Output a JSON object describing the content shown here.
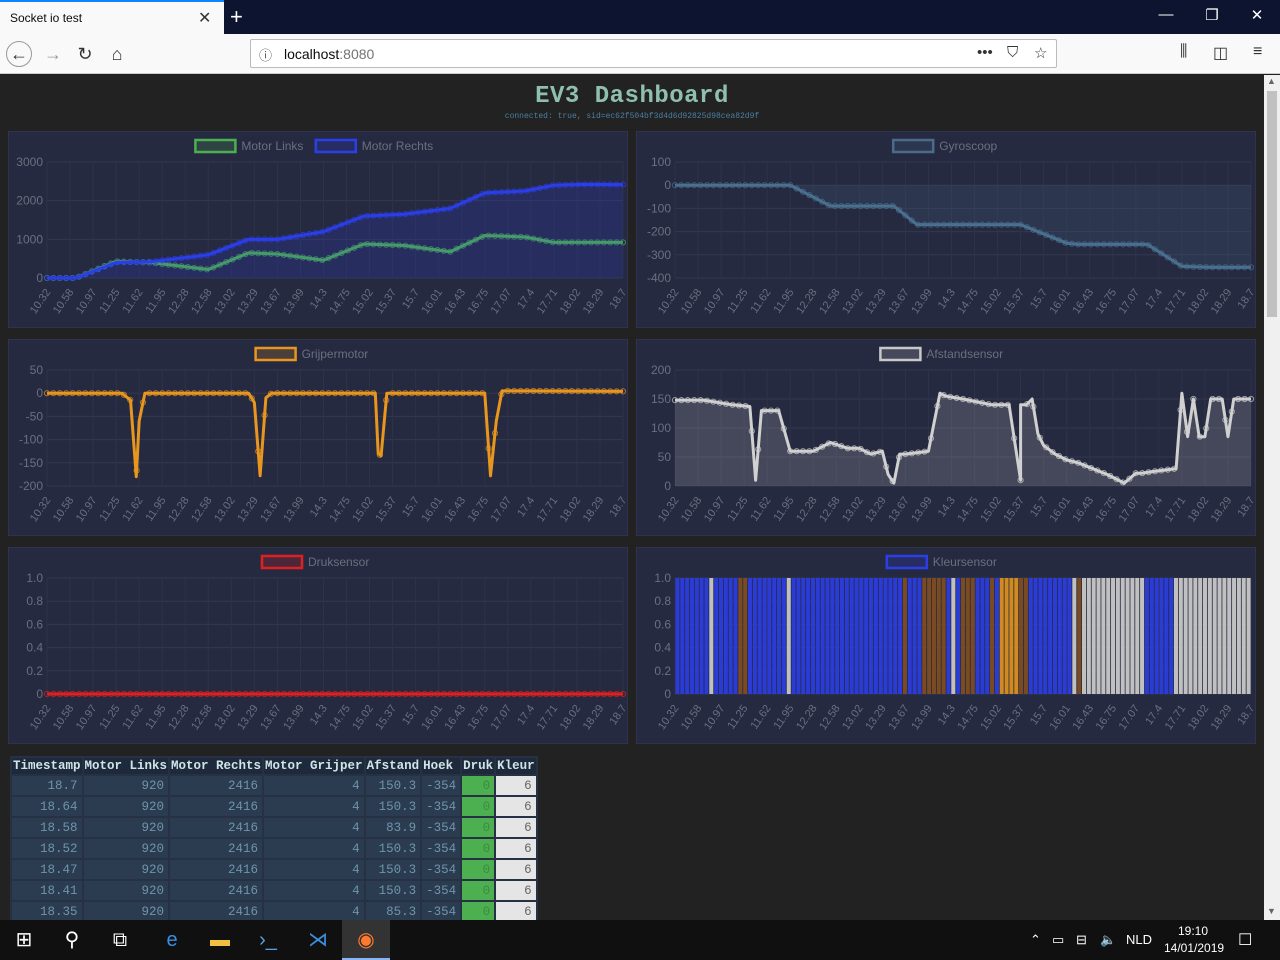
{
  "browser": {
    "tab_title": "Socket io test",
    "tab_close": "✕",
    "new_tab": "+",
    "url_host": "localhost",
    "url_port": ":8080",
    "win_minimize": "—",
    "win_restore": "❐",
    "win_close": "✕"
  },
  "dashboard": {
    "title": "EV3 Dashboard",
    "status": "connected: true, sid=ec62f504bf3d4d6d92825d98cea82d9f"
  },
  "ticks": [
    "10.32",
    "10.58",
    "10.97",
    "11.25",
    "11.62",
    "11.95",
    "12.28",
    "12.58",
    "13.02",
    "13.29",
    "13.67",
    "13.99",
    "14.3",
    "14.75",
    "15.02",
    "15.37",
    "15.7",
    "16.01",
    "16.43",
    "16.75",
    "17.07",
    "17.4",
    "17.71",
    "18.02",
    "18.29",
    "18.7"
  ],
  "chart_data": [
    {
      "type": "line",
      "id": "motors",
      "legend": [
        {
          "name": "Motor Links",
          "color": "#4caf50"
        },
        {
          "name": "Motor Rechts",
          "color": "#2b3ee8"
        }
      ],
      "ylim": [
        0,
        3000
      ],
      "yticks": [
        "3000",
        "2000",
        "1000",
        "0"
      ],
      "series": [
        {
          "name": "Motor Links",
          "color": "#4caf50",
          "x": [
            0,
            0.05,
            0.12,
            0.18,
            0.28,
            0.35,
            0.4,
            0.48,
            0.55,
            0.62,
            0.7,
            0.76,
            0.83,
            0.88,
            0.93,
            1.0
          ],
          "values": [
            0,
            0,
            430,
            400,
            220,
            650,
            620,
            460,
            880,
            840,
            680,
            1100,
            1060,
            920,
            920,
            920
          ]
        },
        {
          "name": "Motor Rechts",
          "color": "#2b3ee8",
          "fill": true,
          "x": [
            0,
            0.05,
            0.12,
            0.18,
            0.28,
            0.35,
            0.4,
            0.48,
            0.55,
            0.62,
            0.7,
            0.76,
            0.83,
            0.88,
            0.93,
            1.0
          ],
          "values": [
            0,
            0,
            400,
            420,
            600,
            1000,
            1000,
            1200,
            1600,
            1650,
            1800,
            2200,
            2250,
            2400,
            2420,
            2416
          ]
        }
      ]
    },
    {
      "type": "line",
      "id": "gyro",
      "legend": [
        {
          "name": "Gyroscoop",
          "color": "#4a6b8a"
        }
      ],
      "ylim": [
        -400,
        100
      ],
      "yticks": [
        "100",
        "0",
        "-100",
        "-200",
        "-300",
        "-400"
      ],
      "series": [
        {
          "name": "Gyroscoop",
          "color": "#4a7090",
          "fill": true,
          "x": [
            0,
            0.17,
            0.2,
            0.27,
            0.38,
            0.42,
            0.5,
            0.6,
            0.63,
            0.68,
            0.7,
            0.76,
            0.82,
            0.88,
            0.93,
            1.0
          ],
          "values": [
            0,
            0,
            0,
            -90,
            -90,
            -170,
            -170,
            -170,
            -200,
            -250,
            -255,
            -255,
            -255,
            -350,
            -354,
            -354
          ]
        }
      ]
    },
    {
      "type": "line",
      "id": "grijper",
      "legend": [
        {
          "name": "Grijpermotor",
          "color": "#e8961e"
        }
      ],
      "ylim": [
        -200,
        50
      ],
      "yticks": [
        "50",
        "0",
        "-50",
        "-100",
        "-150",
        "-200"
      ],
      "series": [
        {
          "name": "Grijpermotor",
          "color": "#e8961e",
          "x": [
            0,
            0.13,
            0.145,
            0.155,
            0.16,
            0.17,
            0.35,
            0.36,
            0.37,
            0.38,
            0.39,
            0.57,
            0.575,
            0.58,
            0.59,
            0.6,
            0.76,
            0.77,
            0.78,
            0.79,
            0.8,
            1.0
          ],
          "values": [
            0,
            0,
            -15,
            -180,
            -60,
            0,
            0,
            -20,
            -178,
            -10,
            0,
            0,
            -130,
            -135,
            0,
            0,
            0,
            -178,
            -60,
            5,
            5,
            4
          ]
        }
      ]
    },
    {
      "type": "line",
      "id": "afstand",
      "legend": [
        {
          "name": "Afstandsensor",
          "color": "#c8c8c8"
        }
      ],
      "ylim": [
        0,
        200
      ],
      "yticks": [
        "200",
        "150",
        "100",
        "50",
        "0"
      ],
      "series": [
        {
          "name": "Afstandsensor",
          "color": "#d0d0d0",
          "fill": true,
          "x": [
            0,
            0.05,
            0.1,
            0.13,
            0.14,
            0.15,
            0.18,
            0.2,
            0.22,
            0.24,
            0.27,
            0.3,
            0.32,
            0.34,
            0.36,
            0.37,
            0.38,
            0.39,
            0.4,
            0.44,
            0.46,
            0.47,
            0.5,
            0.55,
            0.58,
            0.6,
            0.6,
            0.61,
            0.62,
            0.63,
            0.64,
            0.66,
            0.68,
            0.7,
            0.75,
            0.78,
            0.8,
            0.81,
            0.83,
            0.87,
            0.88,
            0.89,
            0.9,
            0.91,
            0.92,
            0.93,
            0.95,
            0.96,
            0.97,
            0.98,
            0.99,
            1.0
          ],
          "values": [
            148,
            148,
            140,
            137,
            10,
            130,
            130,
            60,
            60,
            60,
            75,
            65,
            65,
            55,
            60,
            20,
            5,
            55,
            55,
            60,
            160,
            155,
            150,
            140,
            140,
            10,
            140,
            140,
            150,
            90,
            70,
            55,
            45,
            40,
            20,
            5,
            22,
            22,
            25,
            30,
            160,
            85,
            150,
            85,
            85,
            150,
            150,
            85,
            150,
            150,
            150,
            150
          ]
        }
      ]
    },
    {
      "type": "line",
      "id": "druk",
      "legend": [
        {
          "name": "Druksensor",
          "color": "#e02020"
        }
      ],
      "ylim": [
        0,
        1
      ],
      "yticks": [
        "1.0",
        "0.8",
        "0.6",
        "0.4",
        "0.2",
        "0"
      ],
      "series": [
        {
          "name": "Druksensor",
          "color": "#e02020",
          "x": [
            0,
            1
          ],
          "values": [
            0,
            0
          ]
        }
      ]
    },
    {
      "type": "bar",
      "id": "kleur",
      "legend": [
        {
          "name": "Kleursensor",
          "color": "#2b3ee8"
        }
      ],
      "ylim": [
        0,
        1
      ],
      "yticks": [
        "1.0",
        "0.8",
        "0.6",
        "0.4",
        "0.2",
        "0"
      ],
      "series": [
        {
          "name": "Kleursensor",
          "color": "#2b3ee8",
          "colors": [
            "b",
            "b",
            "b",
            "b",
            "b",
            "b",
            "b",
            "g",
            "b",
            "b",
            "b",
            "b",
            "b",
            "o",
            "o",
            "b",
            "b",
            "b",
            "b",
            "b",
            "b",
            "b",
            "b",
            "g",
            "b",
            "b",
            "b",
            "b",
            "b",
            "b",
            "b",
            "b",
            "b",
            "b",
            "b",
            "b",
            "b",
            "b",
            "b",
            "b",
            "b",
            "b",
            "b",
            "b",
            "b",
            "b",
            "b",
            "o",
            "b",
            "b",
            "b",
            "o",
            "o",
            "o",
            "o",
            "o",
            "b",
            "g",
            "b",
            "o",
            "o",
            "o",
            "b",
            "b",
            "b",
            "o",
            "b",
            "y",
            "y",
            "y",
            "y",
            "o",
            "o",
            "b",
            "b",
            "b",
            "b",
            "b",
            "b",
            "b",
            "b",
            "b",
            "g",
            "o",
            "g",
            "g",
            "g",
            "g",
            "g",
            "g",
            "g",
            "g",
            "g",
            "g",
            "g",
            "g",
            "g",
            "b",
            "b",
            "b",
            "b",
            "b",
            "b",
            "g",
            "g",
            "g",
            "g",
            "g",
            "g",
            "g",
            "g",
            "g",
            "g",
            "g",
            "g",
            "g",
            "g",
            "g",
            "g"
          ],
          "values": "all 1"
        }
      ]
    }
  ],
  "palette": {
    "b": "#2a3bd6",
    "o": "#7a4a22",
    "g": "#c0c0c0",
    "y": "#d08a20"
  },
  "table": {
    "headers": [
      "Timestamp",
      "Motor Links",
      "Motor Rechts",
      "Motor Grijper",
      "Afstand",
      "Hoek",
      "Druk",
      "Kleur"
    ],
    "rows": [
      [
        "18.7",
        "920",
        "2416",
        "4",
        "150.3",
        "-354",
        "0",
        "6"
      ],
      [
        "18.64",
        "920",
        "2416",
        "4",
        "150.3",
        "-354",
        "0",
        "6"
      ],
      [
        "18.58",
        "920",
        "2416",
        "4",
        "83.9",
        "-354",
        "0",
        "6"
      ],
      [
        "18.52",
        "920",
        "2416",
        "4",
        "150.3",
        "-354",
        "0",
        "6"
      ],
      [
        "18.47",
        "920",
        "2416",
        "4",
        "150.3",
        "-354",
        "0",
        "6"
      ],
      [
        "18.41",
        "920",
        "2416",
        "4",
        "150.3",
        "-354",
        "0",
        "6"
      ],
      [
        "18.35",
        "920",
        "2416",
        "4",
        "85.3",
        "-354",
        "0",
        "6"
      ]
    ]
  },
  "taskbar": {
    "lang": "NLD",
    "time": "19:10",
    "date": "14/01/2019"
  }
}
